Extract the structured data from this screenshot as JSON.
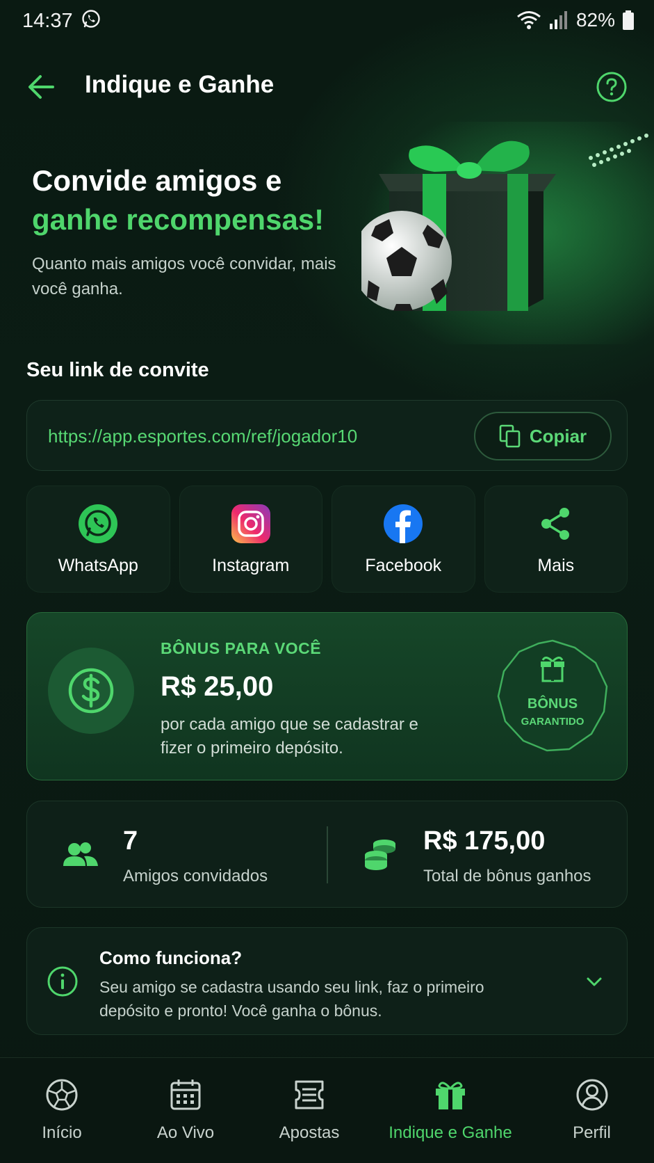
{
  "status_bar": {
    "time": "14:37",
    "battery": "82%"
  },
  "header": {
    "title": "Indique e Ganhe",
    "back_icon": "arrow-left-icon",
    "help_icon": "help-circle-icon"
  },
  "hero": {
    "title_line1": "Convide amigos e",
    "title_line2": "ganhe recompensas!",
    "subtitle": "Quanto mais amigos você convidar, mais você ganha."
  },
  "invite": {
    "section_label": "Seu link de convite",
    "link": "https://app.esportes.com/ref/jogador10",
    "copy_label": "Copiar"
  },
  "share": [
    {
      "label": "WhatsApp",
      "icon": "whatsapp-icon"
    },
    {
      "label": "Instagram",
      "icon": "instagram-icon"
    },
    {
      "label": "Facebook",
      "icon": "facebook-icon"
    },
    {
      "label": "Mais",
      "icon": "share-icon"
    }
  ],
  "bonus": {
    "kicker": "BÔNUS PARA VOCÊ",
    "amount": "R$ 25,00",
    "description": "por cada amigo que se cadastrar e fizer o primeiro depósito.",
    "seal_title": "BÔNUS",
    "seal_sub": "GARANTIDO"
  },
  "stats": {
    "friends_value": "7",
    "friends_label": "Amigos convidados",
    "total_value": "R$ 175,00",
    "total_label": "Total de bônus ganhos"
  },
  "how": {
    "title": "Como funciona?",
    "text": "Seu amigo se cadastra usando seu link, faz o primeiro depósito e pronto! Você ganha o bônus."
  },
  "nav": [
    {
      "label": "Início",
      "icon": "soccer-ball-icon"
    },
    {
      "label": "Ao Vivo",
      "icon": "calendar-icon"
    },
    {
      "label": "Apostas",
      "icon": "ticket-icon"
    },
    {
      "label": "Indique e Ganhe",
      "icon": "gift-icon",
      "active": true
    },
    {
      "label": "Perfil",
      "icon": "profile-icon"
    }
  ],
  "colors": {
    "accent": "#4fd66c",
    "background": "#0a1a12",
    "card": "#0e2018"
  }
}
